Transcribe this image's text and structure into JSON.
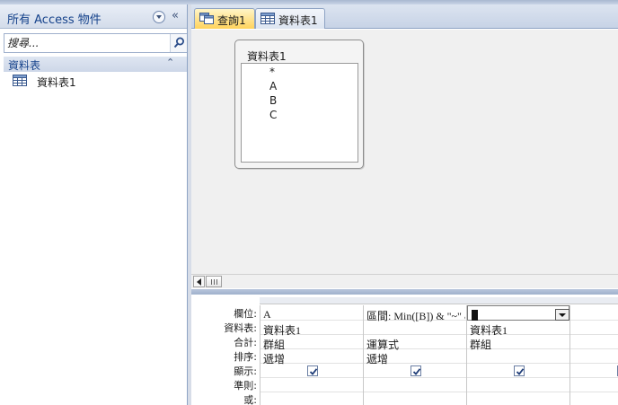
{
  "nav": {
    "title": "所有 Access 物件",
    "collapse_glyph": "«",
    "search_placeholder": "搜尋...",
    "group_title": "資料表",
    "group_chevron": "⌃",
    "items": [
      {
        "label": "資料表1"
      }
    ]
  },
  "tabs": [
    {
      "label": "查詢1",
      "active": true
    },
    {
      "label": "資料表1",
      "active": false
    }
  ],
  "field_list": {
    "title": "資料表1",
    "fields": [
      "*",
      "A",
      "B",
      "C"
    ]
  },
  "grid": {
    "row_labels": [
      "欄位:",
      "資料表:",
      "合計:",
      "排序:",
      "顯示:",
      "準則:",
      "或:"
    ],
    "columns": [
      {
        "field": "A",
        "table": "資料表1",
        "total": "群組",
        "sort": "遞增",
        "show": true
      },
      {
        "field": "區間: Min([B]) & \"~\" &",
        "table": "",
        "total": "運算式",
        "sort": "遞增",
        "show": true
      },
      {
        "field": "",
        "table": "資料表1",
        "total": "群組",
        "sort": "",
        "show": true
      }
    ]
  },
  "colors": {
    "accent": "#15428b",
    "active_tab": "#ffd35c",
    "panel_bg": "#f0f0f0"
  },
  "icons": {
    "table": "table-icon",
    "query": "query-icon",
    "search": "search-icon",
    "dropdown": "chevron-down-icon",
    "checkbox": "checkbox-checked-icon"
  }
}
